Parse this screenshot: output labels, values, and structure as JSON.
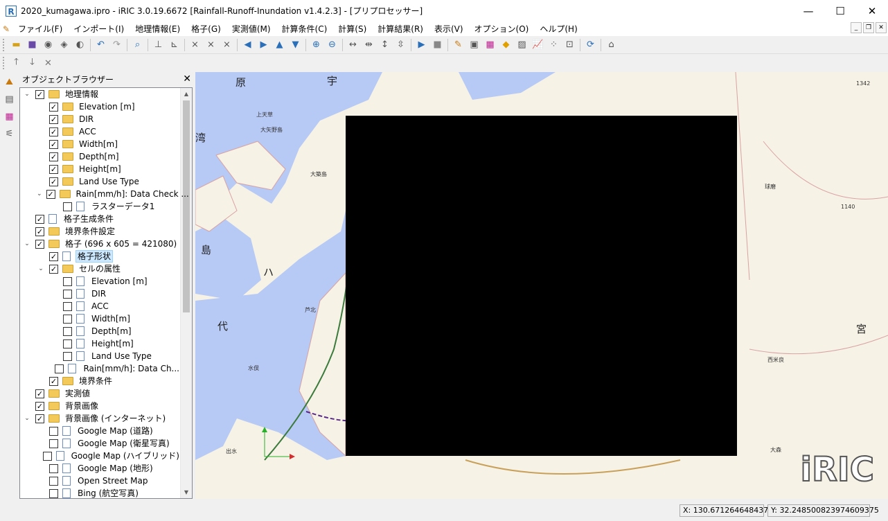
{
  "window": {
    "title": "2020_kumagawa.ipro - iRIC 3.0.19.6672 [Rainfall-Runoff-Inundation v1.4.2.3] - [プリプロセッサー]",
    "minimize": "—",
    "maximize": "☐",
    "close": "✕"
  },
  "menu": {
    "items": [
      "ファイル(F)",
      "インポート(I)",
      "地理情報(E)",
      "格子(G)",
      "実測値(M)",
      "計算条件(C)",
      "計算(S)",
      "計算結果(R)",
      "表示(V)",
      "オプション(O)",
      "ヘルプ(H)"
    ]
  },
  "browser": {
    "title": "オブジェクトブラウザー",
    "rows": [
      {
        "label": "地理情報",
        "level": 0,
        "exp": "open",
        "checked": true,
        "icon": "folder"
      },
      {
        "label": "Elevation [m]",
        "level": 1,
        "exp": "",
        "checked": true,
        "icon": "folder"
      },
      {
        "label": "DIR",
        "level": 1,
        "exp": "",
        "checked": true,
        "icon": "folder"
      },
      {
        "label": "ACC",
        "level": 1,
        "exp": "",
        "checked": true,
        "icon": "folder"
      },
      {
        "label": "Width[m]",
        "level": 1,
        "exp": "",
        "checked": true,
        "icon": "folder"
      },
      {
        "label": "Depth[m]",
        "level": 1,
        "exp": "",
        "checked": true,
        "icon": "folder"
      },
      {
        "label": "Height[m]",
        "level": 1,
        "exp": "",
        "checked": true,
        "icon": "folder"
      },
      {
        "label": "Land Use Type",
        "level": 1,
        "exp": "",
        "checked": true,
        "icon": "folder"
      },
      {
        "label": "Rain[mm/h]: Data Check ...",
        "level": 1,
        "exp": "open",
        "checked": true,
        "icon": "folder"
      },
      {
        "label": "ラスターデータ1",
        "level": 2,
        "exp": "",
        "checked": false,
        "icon": "doc"
      },
      {
        "label": "格子生成条件",
        "level": 0,
        "exp": "",
        "checked": true,
        "icon": "doc"
      },
      {
        "label": "境界条件設定",
        "level": 0,
        "exp": "",
        "checked": true,
        "icon": "folder"
      },
      {
        "label": "格子 (696 x 605 = 421080)",
        "level": 0,
        "exp": "open",
        "checked": true,
        "icon": "folder"
      },
      {
        "label": "格子形状",
        "level": 1,
        "exp": "",
        "checked": true,
        "icon": "doc",
        "selected": true
      },
      {
        "label": "セルの属性",
        "level": 1,
        "exp": "open",
        "checked": true,
        "icon": "folder"
      },
      {
        "label": "Elevation [m]",
        "level": 2,
        "exp": "",
        "checked": false,
        "icon": "doc"
      },
      {
        "label": "DIR",
        "level": 2,
        "exp": "",
        "checked": false,
        "icon": "doc"
      },
      {
        "label": "ACC",
        "level": 2,
        "exp": "",
        "checked": false,
        "icon": "doc"
      },
      {
        "label": "Width[m]",
        "level": 2,
        "exp": "",
        "checked": false,
        "icon": "doc"
      },
      {
        "label": "Depth[m]",
        "level": 2,
        "exp": "",
        "checked": false,
        "icon": "doc"
      },
      {
        "label": "Height[m]",
        "level": 2,
        "exp": "",
        "checked": false,
        "icon": "doc"
      },
      {
        "label": "Land Use Type",
        "level": 2,
        "exp": "",
        "checked": false,
        "icon": "doc"
      },
      {
        "label": "Rain[mm/h]: Data Ch...",
        "level": 2,
        "exp": "",
        "checked": false,
        "icon": "doc"
      },
      {
        "label": "境界条件",
        "level": 1,
        "exp": "",
        "checked": true,
        "icon": "folder"
      },
      {
        "label": "実測値",
        "level": 0,
        "exp": "",
        "checked": true,
        "icon": "folder"
      },
      {
        "label": "背景画像",
        "level": 0,
        "exp": "",
        "checked": true,
        "icon": "folder"
      },
      {
        "label": "背景画像 (インターネット)",
        "level": 0,
        "exp": "open",
        "checked": true,
        "icon": "folder"
      },
      {
        "label": "Google Map (道路)",
        "level": 1,
        "exp": "",
        "checked": false,
        "icon": "doc"
      },
      {
        "label": "Google Map (衛星写真)",
        "level": 1,
        "exp": "",
        "checked": false,
        "icon": "doc"
      },
      {
        "label": "Google Map (ハイブリッド)",
        "level": 1,
        "exp": "",
        "checked": false,
        "icon": "doc"
      },
      {
        "label": "Google Map (地形)",
        "level": 1,
        "exp": "",
        "checked": false,
        "icon": "doc"
      },
      {
        "label": "Open Street Map",
        "level": 1,
        "exp": "",
        "checked": false,
        "icon": "doc"
      },
      {
        "label": "Bing (航空写真)",
        "level": 1,
        "exp": "",
        "checked": false,
        "icon": "doc"
      }
    ]
  },
  "map": {
    "labels": [
      "原",
      "宇",
      "湾",
      "島",
      "ハ",
      "代",
      "宮"
    ],
    "small_labels": [
      "上天草",
      "大矢野島",
      "大築島",
      "芦北",
      "水俣",
      "出水",
      "西米良",
      "大森",
      "球磨",
      "1342",
      "1140"
    ]
  },
  "status": {
    "x": "X: 130.67126464843​75",
    "y": "Y: 32.24850082397460​9375"
  },
  "logo": "iRIC"
}
